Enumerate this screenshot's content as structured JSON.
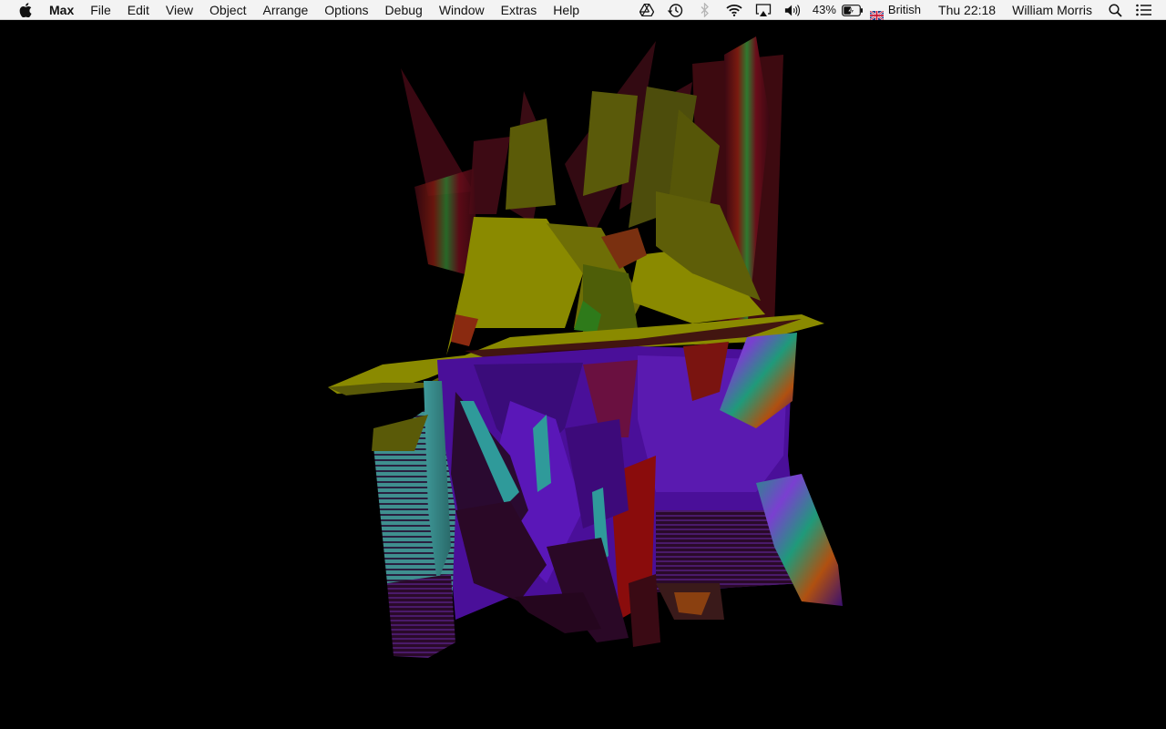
{
  "menubar": {
    "app_name": "Max",
    "menus": [
      "File",
      "Edit",
      "View",
      "Object",
      "Arrange",
      "Options",
      "Debug",
      "Window",
      "Extras",
      "Help"
    ],
    "status": {
      "battery_percent": "43%",
      "input_source": "British",
      "clock": "Thu 22:18",
      "user_name": "William Morris"
    },
    "icons": {
      "apple": "apple-logo-icon",
      "drive": "google-drive-icon",
      "time_machine": "time-machine-icon",
      "bluetooth": "bluetooth-icon",
      "wifi": "wifi-icon",
      "airplay": "airplay-icon",
      "volume": "volume-icon",
      "battery": "battery-charging-icon",
      "flag": "uk-flag-icon",
      "spotlight": "search-icon",
      "notification_center": "notification-center-icon"
    }
  },
  "colors": {
    "menubar_bg": "#f3f3f3",
    "desktop_bg": "#000000",
    "yellow": "#8a8a00",
    "purple": "#4a0f99",
    "teal": "#3f8f8f",
    "maroon": "#3a0812",
    "red": "#8a0c0c"
  }
}
